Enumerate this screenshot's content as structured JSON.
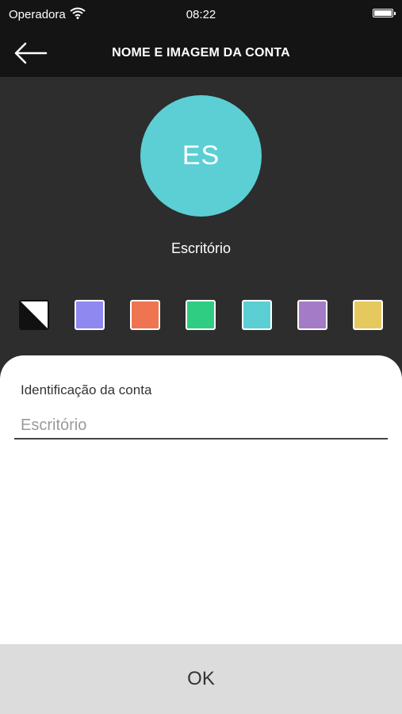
{
  "status_bar": {
    "carrier": "Operadora",
    "time": "08:22",
    "wifi_icon": "wifi-icon",
    "battery_icon": "battery-icon"
  },
  "header": {
    "title": "NOME E IMAGEM DA CONTA",
    "back_icon": "arrow-left-icon"
  },
  "avatar": {
    "initials": "ES",
    "color": "#5bcfd4"
  },
  "account_name": "Escritório",
  "colors": [
    {
      "name": "none",
      "value": "none"
    },
    {
      "name": "blue",
      "value": "#8f88f0"
    },
    {
      "name": "orange",
      "value": "#ee7550"
    },
    {
      "name": "green",
      "value": "#2fcd82"
    },
    {
      "name": "cyan",
      "value": "#5bcfd4"
    },
    {
      "name": "purple",
      "value": "#a37bc6"
    },
    {
      "name": "yellow",
      "value": "#e6c95e"
    }
  ],
  "form": {
    "label": "Identificação da conta",
    "value": "",
    "placeholder": "Escritório"
  },
  "footer": {
    "ok_label": "OK"
  }
}
